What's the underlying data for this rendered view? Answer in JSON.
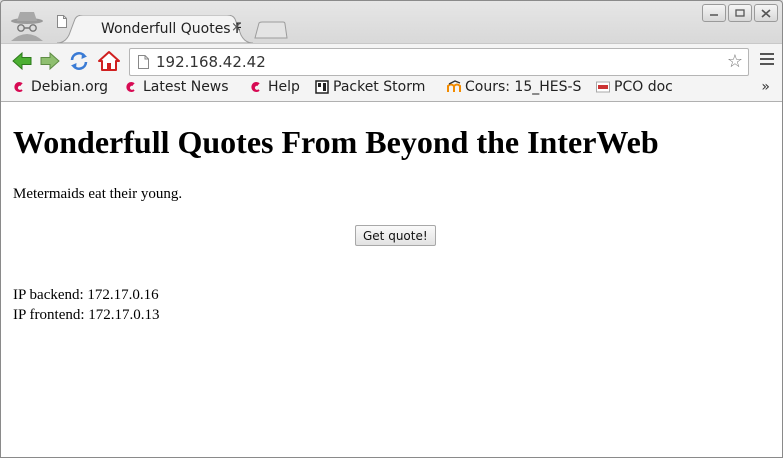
{
  "browser": {
    "tab_title": "Wonderfull Quotes From Beyond the InterWeb",
    "tab_close": "×",
    "address": "192.168.42.42",
    "bookmarks_more": "»"
  },
  "bookmarks": [
    {
      "label": "Debian.org",
      "icon": "debian-icon"
    },
    {
      "label": "Latest News",
      "icon": "debian-icon"
    },
    {
      "label": "Help",
      "icon": "debian-icon"
    },
    {
      "label": "Packet Storm",
      "icon": "packet-storm-icon"
    },
    {
      "label": "Cours: 15_HES-S",
      "icon": "moodle-icon"
    },
    {
      "label": "PCO doc",
      "icon": "pco-doc-icon"
    }
  ],
  "page": {
    "heading": "Wonderfull Quotes From Beyond the InterWeb",
    "quote": "Metermaids eat their young.",
    "button_label": "Get quote!",
    "ip_backend": "IP backend: 172.17.0.16",
    "ip_frontend": "IP frontend: 172.17.0.13"
  },
  "colors": {
    "debian_red": "#d70a53",
    "back_forward_green": "#3a9d23",
    "home_red": "#d02020",
    "reload_blue": "#3a7bd5"
  }
}
